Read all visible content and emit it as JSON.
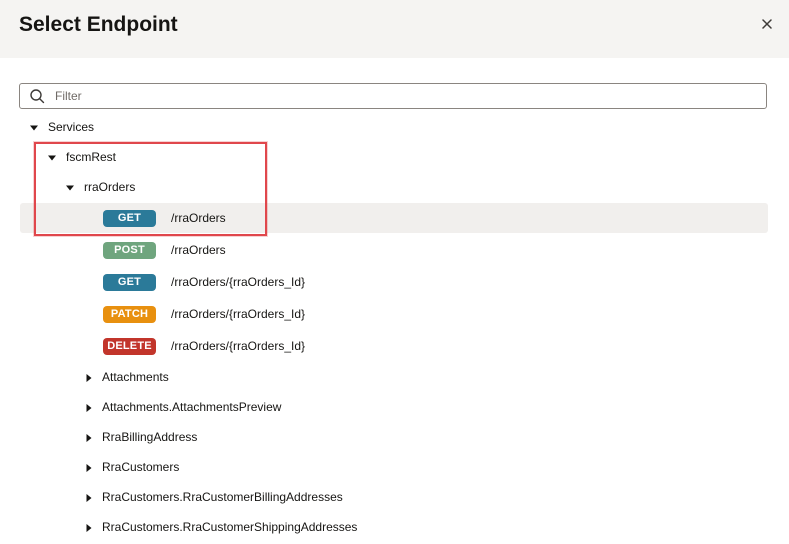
{
  "dialog": {
    "title": "Select Endpoint",
    "close_icon": "close-icon",
    "filter": {
      "placeholder": "Filter",
      "value": ""
    }
  },
  "tree": {
    "root": {
      "label": "Services",
      "expanded": true
    },
    "service": {
      "label": "fscmRest",
      "expanded": true
    },
    "resource": {
      "label": "rraOrders",
      "expanded": true
    },
    "endpoints": [
      {
        "method": "GET",
        "path": "/rraOrders",
        "color": "#2b7a99",
        "selected": true
      },
      {
        "method": "POST",
        "path": "/rraOrders",
        "color": "#6fa57e",
        "selected": false
      },
      {
        "method": "GET",
        "path": "/rraOrders/{rraOrders_Id}",
        "color": "#2b7a99",
        "selected": false
      },
      {
        "method": "PATCH",
        "path": "/rraOrders/{rraOrders_Id}",
        "color": "#e8900f",
        "selected": false
      },
      {
        "method": "DELETE",
        "path": "/rraOrders/{rraOrders_Id}",
        "color": "#c2352b",
        "selected": false
      }
    ],
    "children": [
      {
        "label": "Attachments"
      },
      {
        "label": "Attachments.AttachmentsPreview"
      },
      {
        "label": "RraBillingAddress"
      },
      {
        "label": "RraCustomers"
      },
      {
        "label": "RraCustomers.RraCustomerBillingAddresses"
      },
      {
        "label": "RraCustomers.RraCustomerShippingAddresses"
      }
    ]
  },
  "colors": {
    "header_bg": "#f5f4f2",
    "selected_row_bg": "#f1efed",
    "annotation_border": "#e0474c"
  }
}
